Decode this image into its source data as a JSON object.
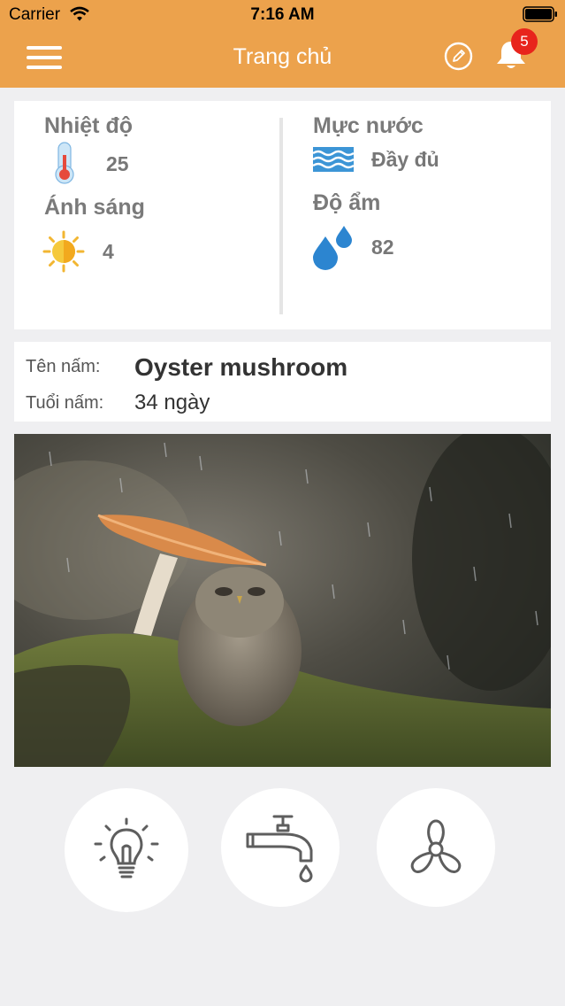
{
  "status_bar": {
    "carrier": "Carrier",
    "time": "7:16 AM"
  },
  "header": {
    "title": "Trang chủ",
    "notification_count": "5"
  },
  "sensors": {
    "temperature": {
      "label": "Nhiệt độ",
      "value": "25"
    },
    "light": {
      "label": "Ánh sáng",
      "value": "4"
    },
    "water_level": {
      "label": "Mực nước",
      "value": "Đầy đủ"
    },
    "humidity": {
      "label": "Độ ẩm",
      "value": "82"
    }
  },
  "mushroom": {
    "name_label": "Tên nấm:",
    "name": "Oyster mushroom",
    "age_label": "Tuổi nấm:",
    "age": "34 ngày"
  },
  "controls": [
    {
      "icon": "light-bulb-icon"
    },
    {
      "icon": "water-tap-icon"
    },
    {
      "icon": "fan-icon"
    }
  ],
  "colors": {
    "header": "#ECA24C",
    "background": "#EFEFF1",
    "badge": "#E8241C"
  }
}
